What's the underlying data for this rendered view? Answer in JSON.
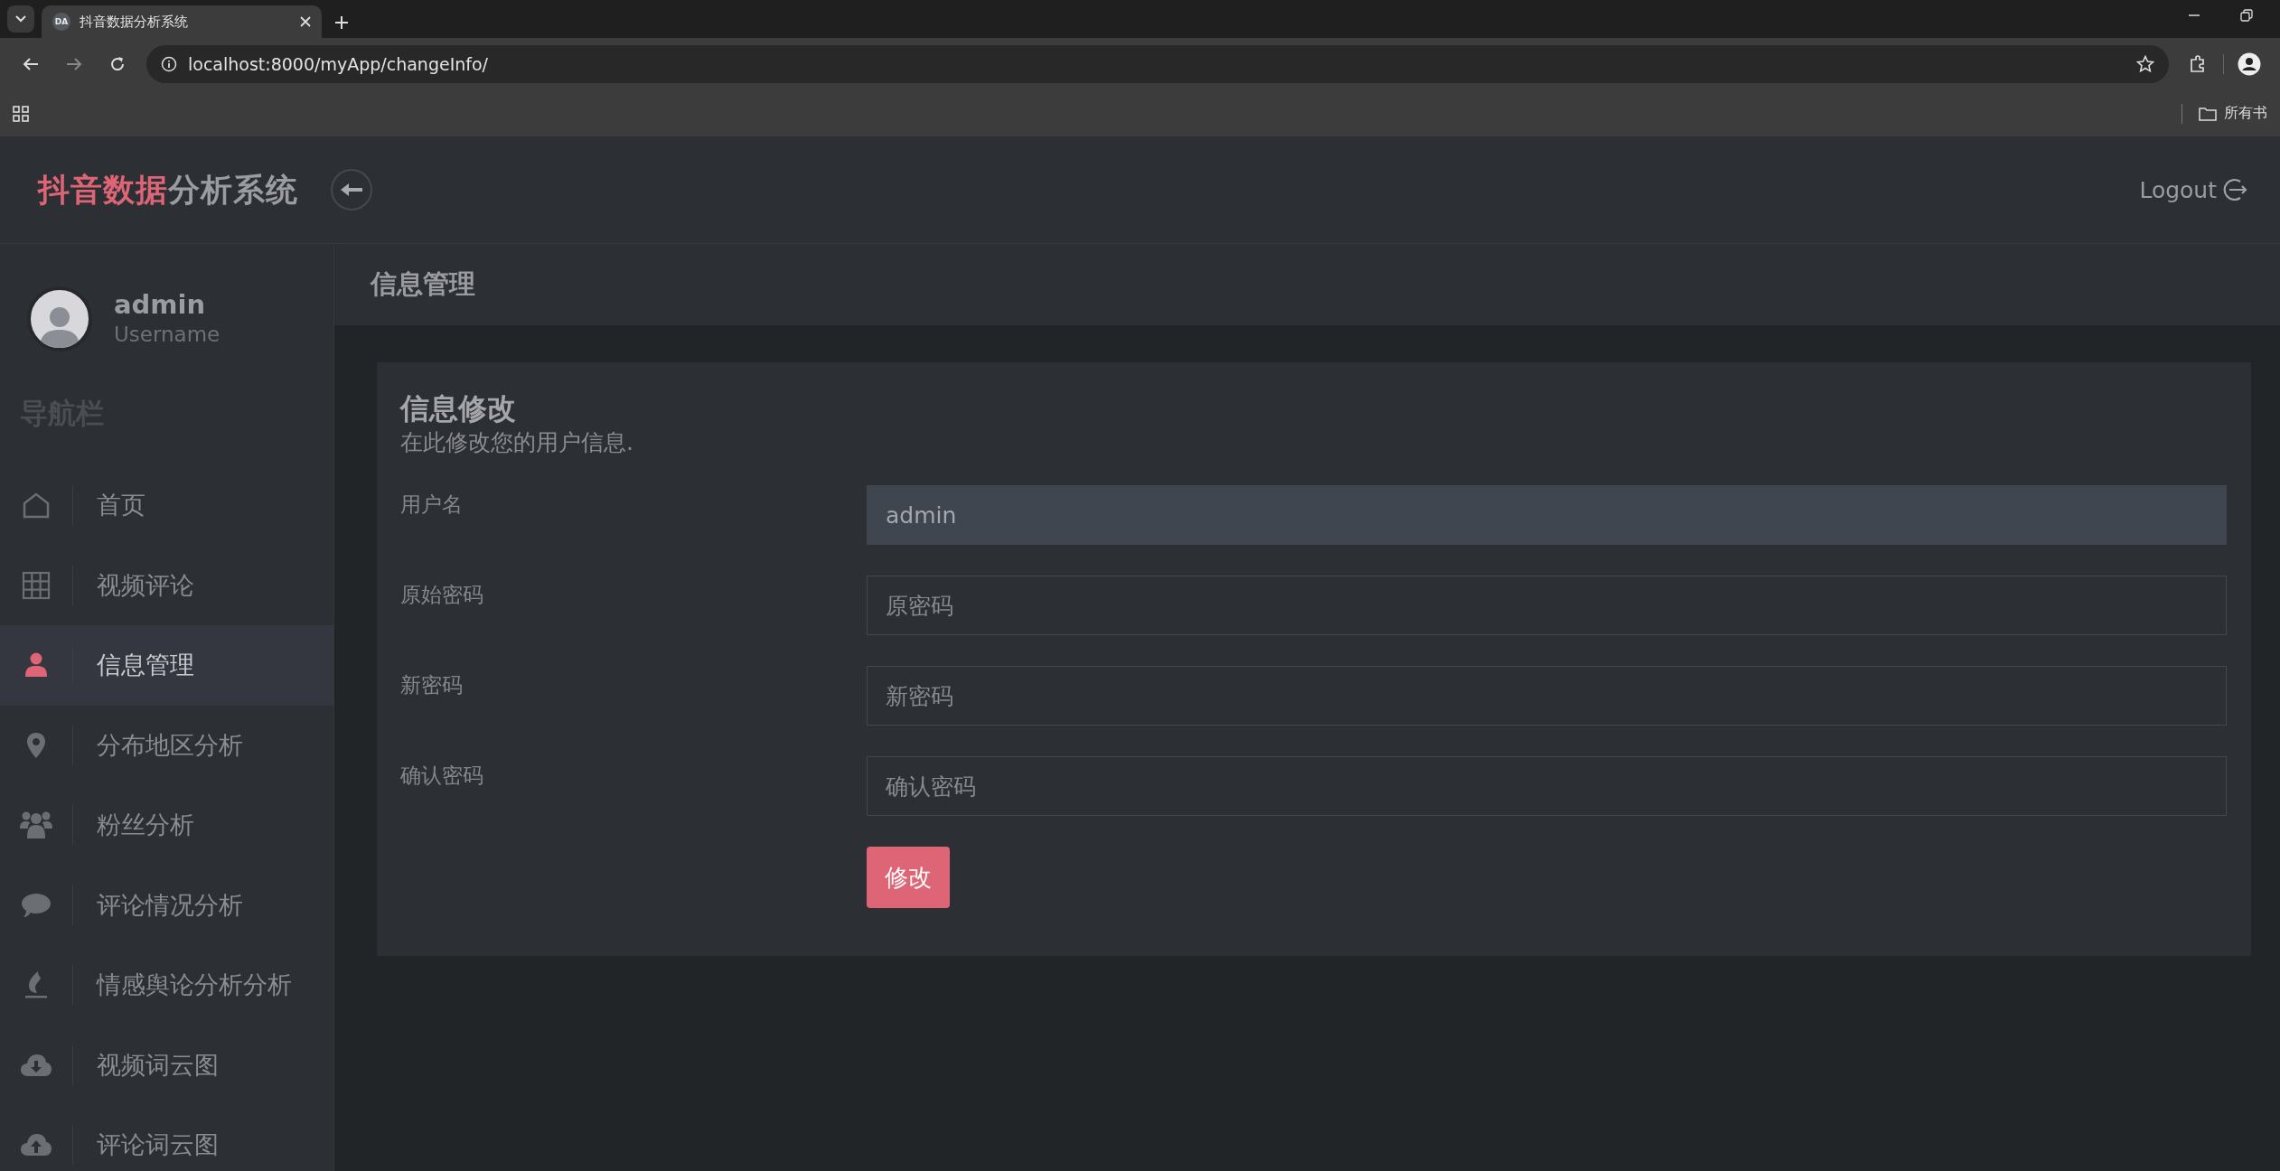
{
  "browser": {
    "tab": {
      "favicon": "DA",
      "title": "抖音数据分析系统"
    },
    "url": "localhost:8000/myApp/changeInfo/",
    "bookmarks_folder": "所有书"
  },
  "header": {
    "logo_accent": "抖音数据",
    "logo_rest": "分析系统",
    "logout": "Logout"
  },
  "user": {
    "name": "admin",
    "role": "Username"
  },
  "sidebar": {
    "title": "导航栏",
    "items": [
      {
        "label": "首页",
        "selected": false
      },
      {
        "label": "视频评论",
        "selected": false
      },
      {
        "label": "信息管理",
        "selected": true
      },
      {
        "label": "分布地区分析",
        "selected": false
      },
      {
        "label": "粉丝分析",
        "selected": false
      },
      {
        "label": "评论情况分析",
        "selected": false
      },
      {
        "label": "情感舆论分析分析",
        "selected": false
      },
      {
        "label": "视频词云图",
        "selected": false
      },
      {
        "label": "评论词云图",
        "selected": false
      }
    ]
  },
  "page": {
    "title": "信息管理"
  },
  "form": {
    "title": "信息修改",
    "subtitle": "在此修改您的用户信息.",
    "fields": [
      {
        "label": "用户名",
        "value": "admin",
        "readonly": true
      },
      {
        "label": "原始密码",
        "placeholder": "原密码",
        "readonly": false
      },
      {
        "label": "新密码",
        "placeholder": "新密码",
        "readonly": false
      },
      {
        "label": "确认密码",
        "placeholder": "确认密码",
        "readonly": false
      }
    ],
    "submit": "修改"
  }
}
